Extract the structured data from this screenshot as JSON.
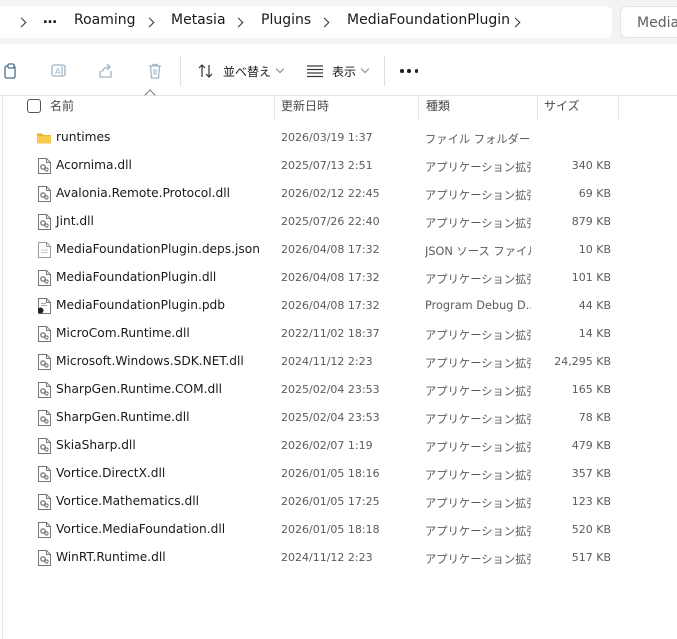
{
  "breadcrumb": {
    "more": "…",
    "items": [
      "Roaming",
      "Metasia",
      "Plugins",
      "MediaFoundationPlugin"
    ]
  },
  "search": {
    "placeholder": "MediaF"
  },
  "toolbar": {
    "sort_label": "並べ替え",
    "view_label": "表示",
    "icons": [
      "copy-icon",
      "rename-icon",
      "share-icon",
      "delete-icon",
      "sort-icon",
      "view-icon",
      "more-icon"
    ]
  },
  "columns": {
    "name": "名前",
    "date": "更新日時",
    "type": "種類",
    "size": "サイズ"
  },
  "files": [
    {
      "name": "runtimes",
      "date": "2026/03/19 1:37",
      "type": "ファイル フォルダー",
      "size": "",
      "icon": "folder-icon"
    },
    {
      "name": "Acornima.dll",
      "date": "2025/07/13 2:51",
      "type": "アプリケーション拡張",
      "size": "340 KB",
      "icon": "dll-icon"
    },
    {
      "name": "Avalonia.Remote.Protocol.dll",
      "date": "2026/02/12 22:45",
      "type": "アプリケーション拡張",
      "size": "69 KB",
      "icon": "dll-icon"
    },
    {
      "name": "Jint.dll",
      "date": "2025/07/26 22:40",
      "type": "アプリケーション拡張",
      "size": "879 KB",
      "icon": "dll-icon"
    },
    {
      "name": "MediaFoundationPlugin.deps.json",
      "date": "2026/04/08 17:32",
      "type": "JSON ソース ファイル",
      "size": "10 KB",
      "icon": "json-icon"
    },
    {
      "name": "MediaFoundationPlugin.dll",
      "date": "2026/04/08 17:32",
      "type": "アプリケーション拡張",
      "size": "101 KB",
      "icon": "dll-icon"
    },
    {
      "name": "MediaFoundationPlugin.pdb",
      "date": "2026/04/08 17:32",
      "type": "Program Debug D...",
      "size": "44 KB",
      "icon": "pdb-icon"
    },
    {
      "name": "MicroCom.Runtime.dll",
      "date": "2022/11/02 18:37",
      "type": "アプリケーション拡張",
      "size": "14 KB",
      "icon": "dll-icon"
    },
    {
      "name": "Microsoft.Windows.SDK.NET.dll",
      "date": "2024/11/12 2:23",
      "type": "アプリケーション拡張",
      "size": "24,295 KB",
      "icon": "dll-icon"
    },
    {
      "name": "SharpGen.Runtime.COM.dll",
      "date": "2025/02/04 23:53",
      "type": "アプリケーション拡張",
      "size": "165 KB",
      "icon": "dll-icon"
    },
    {
      "name": "SharpGen.Runtime.dll",
      "date": "2025/02/04 23:53",
      "type": "アプリケーション拡張",
      "size": "78 KB",
      "icon": "dll-icon"
    },
    {
      "name": "SkiaSharp.dll",
      "date": "2026/02/07 1:19",
      "type": "アプリケーション拡張",
      "size": "479 KB",
      "icon": "dll-icon"
    },
    {
      "name": "Vortice.DirectX.dll",
      "date": "2026/01/05 18:16",
      "type": "アプリケーション拡張",
      "size": "357 KB",
      "icon": "dll-icon"
    },
    {
      "name": "Vortice.Mathematics.dll",
      "date": "2026/01/05 17:25",
      "type": "アプリケーション拡張",
      "size": "123 KB",
      "icon": "dll-icon"
    },
    {
      "name": "Vortice.MediaFoundation.dll",
      "date": "2026/01/05 18:18",
      "type": "アプリケーション拡張",
      "size": "520 KB",
      "icon": "dll-icon"
    },
    {
      "name": "WinRT.Runtime.dll",
      "date": "2024/11/12 2:23",
      "type": "アプリケーション拡張",
      "size": "517 KB",
      "icon": "dll-icon"
    }
  ],
  "colors": {
    "folder": "#f3c442",
    "accent": "#0067c0",
    "toolbar_icon_disabled": "#9fb3c8"
  }
}
